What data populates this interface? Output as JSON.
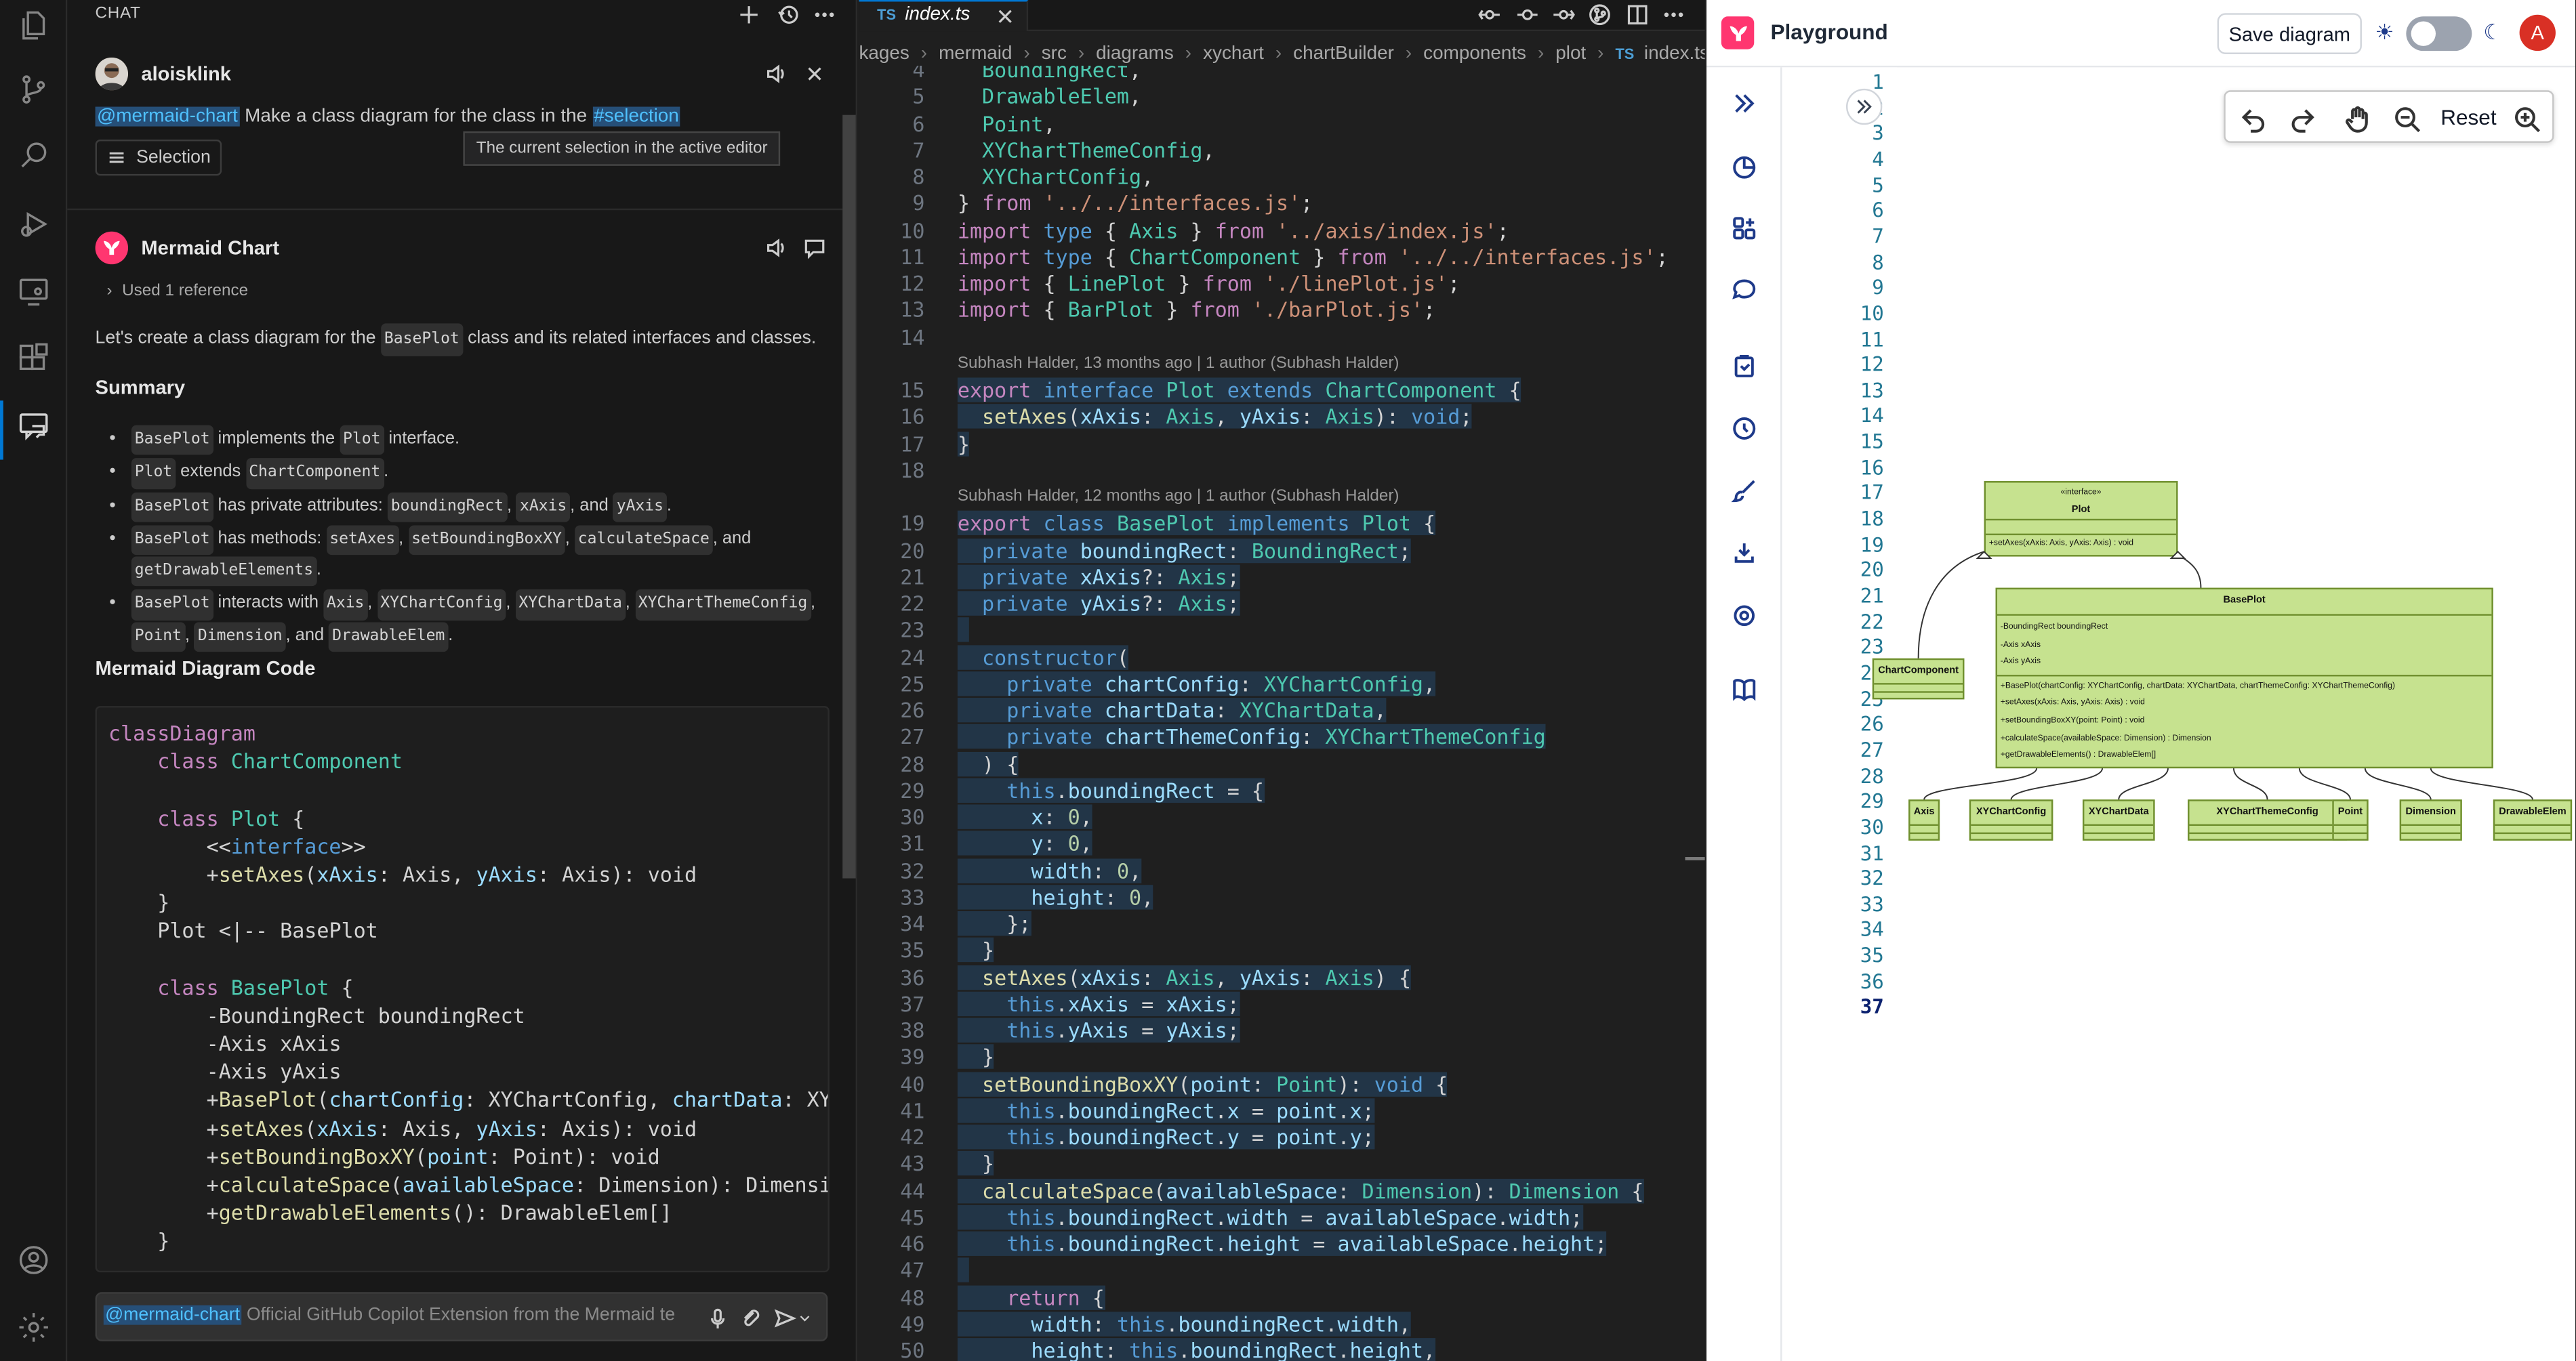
{
  "chat": {
    "title": "CHAT",
    "user": {
      "name": "aloisklink",
      "mention": "@mermaid-chart",
      "message": "Make a class diagram for the class in the",
      "selection_tag": "#selection",
      "selection_chip": "Selection",
      "tooltip": "The current selection in the active editor"
    },
    "bot": {
      "name": "Mermaid Chart",
      "used_refs": "Used 1 reference",
      "intro_a": "Let's create a class diagram for the",
      "intro_chip": "BasePlot",
      "intro_b": "class and its related interfaces and classes.",
      "summary_heading": "Summary",
      "summary": [
        [
          {
            "c": "BasePlot"
          },
          {
            "t": " implements the "
          },
          {
            "c": "Plot"
          },
          {
            "t": " interface."
          }
        ],
        [
          {
            "c": "Plot"
          },
          {
            "t": " extends "
          },
          {
            "c": "ChartComponent"
          },
          {
            "t": "."
          }
        ],
        [
          {
            "c": "BasePlot"
          },
          {
            "t": " has private attributes: "
          },
          {
            "c": "boundingRect"
          },
          {
            "t": ", "
          },
          {
            "c": "xAxis"
          },
          {
            "t": ", and "
          },
          {
            "c": "yAxis"
          },
          {
            "t": "."
          }
        ],
        [
          {
            "c": "BasePlot"
          },
          {
            "t": " has methods: "
          },
          {
            "c": "setAxes"
          },
          {
            "t": ", "
          },
          {
            "c": "setBoundingBoxXY"
          },
          {
            "t": ", "
          },
          {
            "c": "calculateSpace"
          },
          {
            "t": ", and "
          },
          {
            "c": "getDrawableElements"
          },
          {
            "t": "."
          }
        ],
        [
          {
            "c": "BasePlot"
          },
          {
            "t": " interacts with "
          },
          {
            "c": "Axis"
          },
          {
            "t": ", "
          },
          {
            "c": "XYChartConfig"
          },
          {
            "t": ", "
          },
          {
            "c": "XYChartData"
          },
          {
            "t": ", "
          },
          {
            "c": "XYChartThemeConfig"
          },
          {
            "t": ", "
          },
          {
            "c": "Point"
          },
          {
            "t": ", "
          },
          {
            "c": "Dimension"
          },
          {
            "t": ", and "
          },
          {
            "c": "DrawableElem"
          },
          {
            "t": "."
          }
        ]
      ],
      "code_heading": "Mermaid Diagram Code",
      "code_lines": [
        "classDiagram",
        "    class ChartComponent",
        "",
        "    class Plot {",
        "        <<interface>>",
        "        +setAxes(xAxis: Axis, yAxis: Axis): void",
        "    }",
        "    Plot <|-- BasePlot",
        "",
        "    class BasePlot {",
        "        -BoundingRect boundingRect",
        "        -Axis xAxis",
        "        -Axis yAxis",
        "        +BasePlot(chartConfig: XYChartConfig, chartData: XYChartData, chartThemeConfig: XYChartThemeConfig)",
        "        +setAxes(xAxis: Axis, yAxis: Axis): void",
        "        +setBoundingBoxXY(point: Point): void",
        "        +calculateSpace(availableSpace: Dimension): Dimension",
        "        +getDrawableElements(): DrawableElem[]",
        "    }"
      ]
    },
    "input": {
      "mention": "@mermaid-chart",
      "placeholder": "Official GitHub Copilot Extension from the Mermaid te"
    }
  },
  "editor": {
    "tab": {
      "lang": "TS",
      "name": "index.ts"
    },
    "breadcrumbs": [
      "kages",
      "mermaid",
      "src",
      "diagrams",
      "xychart",
      "chartBuilder",
      "components",
      "plot",
      "index.ts"
    ],
    "breadcrumb_lang": "TS",
    "blame": [
      {
        "before": 15,
        "text": "Subhash Halder, 13 months ago | 1 author (Subhash Halder)"
      },
      {
        "before": 19,
        "text": "Subhash Halder, 12 months ago | 1 author (Subhash Halder)"
      }
    ],
    "lines": [
      {
        "n": 4,
        "code": "  BoundingRect,"
      },
      {
        "n": 5,
        "code": "  DrawableElem,"
      },
      {
        "n": 6,
        "code": "  Point,"
      },
      {
        "n": 7,
        "code": "  XYChartThemeConfig,"
      },
      {
        "n": 8,
        "code": "  XYChartConfig,"
      },
      {
        "n": 9,
        "code": "} from '../../interfaces.js';"
      },
      {
        "n": 10,
        "code": "import type { Axis } from '../axis/index.js';"
      },
      {
        "n": 11,
        "code": "import type { ChartComponent } from '../../interfaces.js';"
      },
      {
        "n": 12,
        "code": "import { LinePlot } from './linePlot.js';"
      },
      {
        "n": 13,
        "code": "import { BarPlot } from './barPlot.js';"
      },
      {
        "n": 14,
        "code": ""
      },
      {
        "n": 15,
        "code": "export interface Plot extends ChartComponent {"
      },
      {
        "n": 16,
        "code": "  setAxes(xAxis: Axis, yAxis: Axis): void;"
      },
      {
        "n": 17,
        "code": "}"
      },
      {
        "n": 18,
        "code": ""
      },
      {
        "n": 19,
        "code": "export class BasePlot implements Plot {"
      },
      {
        "n": 20,
        "code": "  private boundingRect: BoundingRect;"
      },
      {
        "n": 21,
        "code": "  private xAxis?: Axis;"
      },
      {
        "n": 22,
        "code": "  private yAxis?: Axis;"
      },
      {
        "n": 23,
        "code": ""
      },
      {
        "n": 24,
        "code": "  constructor("
      },
      {
        "n": 25,
        "code": "    private chartConfig: XYChartConfig,"
      },
      {
        "n": 26,
        "code": "    private chartData: XYChartData,"
      },
      {
        "n": 27,
        "code": "    private chartThemeConfig: XYChartThemeConfig"
      },
      {
        "n": 28,
        "code": "  ) {"
      },
      {
        "n": 29,
        "code": "    this.boundingRect = {"
      },
      {
        "n": 30,
        "code": "      x: 0,"
      },
      {
        "n": 31,
        "code": "      y: 0,"
      },
      {
        "n": 32,
        "code": "      width: 0,"
      },
      {
        "n": 33,
        "code": "      height: 0,"
      },
      {
        "n": 34,
        "code": "    };"
      },
      {
        "n": 35,
        "code": "  }"
      },
      {
        "n": 36,
        "code": "  setAxes(xAxis: Axis, yAxis: Axis) {"
      },
      {
        "n": 37,
        "code": "    this.xAxis = xAxis;"
      },
      {
        "n": 38,
        "code": "    this.yAxis = yAxis;"
      },
      {
        "n": 39,
        "code": "  }"
      },
      {
        "n": 40,
        "code": "  setBoundingBoxXY(point: Point): void {"
      },
      {
        "n": 41,
        "code": "    this.boundingRect.x = point.x;"
      },
      {
        "n": 42,
        "code": "    this.boundingRect.y = point.y;"
      },
      {
        "n": 43,
        "code": "  }"
      },
      {
        "n": 44,
        "code": "  calculateSpace(availableSpace: Dimension): Dimension {"
      },
      {
        "n": 45,
        "code": "    this.boundingRect.width = availableSpace.width;"
      },
      {
        "n": 46,
        "code": "    this.boundingRect.height = availableSpace.height;"
      },
      {
        "n": 47,
        "code": ""
      },
      {
        "n": 48,
        "code": "    return {"
      },
      {
        "n": 49,
        "code": "      width: this.boundingRect.width,"
      },
      {
        "n": 50,
        "code": "      height: this.boundingRect.height,"
      }
    ]
  },
  "playground": {
    "title": "Playground",
    "save_label": "Save diagram",
    "avatar_letter": "A",
    "reset_label": "Reset",
    "line_count": 37,
    "diagram": {
      "plot": {
        "stereotype": "«interface»",
        "name": "Plot",
        "methods": [
          "+setAxes(xAxis: Axis, yAxis: Axis) : void"
        ]
      },
      "baseplot": {
        "name": "BasePlot",
        "attrs": [
          "-BoundingRect boundingRect",
          "-Axis xAxis",
          "-Axis yAxis"
        ],
        "methods": [
          "+BasePlot(chartConfig: XYChartConfig, chartData: XYChartData, chartThemeConfig: XYChartThemeConfig)",
          "+setAxes(xAxis: Axis, yAxis: Axis) : void",
          "+setBoundingBoxXY(point: Point) : void",
          "+calculateSpace(availableSpace: Dimension) : Dimension",
          "+getDrawableElements() : DrawableElem[]"
        ]
      },
      "chartcomponent": {
        "name": "ChartComponent"
      },
      "deps": [
        "Axis",
        "XYChartConfig",
        "XYChartData",
        "XYChartThemeConfig",
        "Point",
        "Dimension",
        "DrawableElem"
      ]
    }
  }
}
